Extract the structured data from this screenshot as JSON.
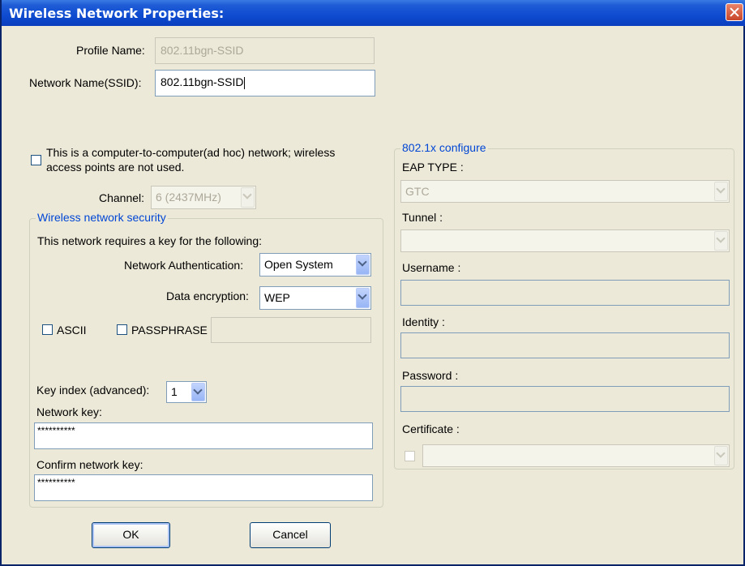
{
  "window": {
    "title": "Wireless Network Properties:"
  },
  "profile": {
    "label": "Profile Name:",
    "value": "802.11bgn-SSID"
  },
  "ssid": {
    "label": "Network Name(SSID):",
    "value": "802.11bgn-SSID"
  },
  "adhoc": {
    "label_line1": "This is a computer-to-computer(ad hoc) network; wireless",
    "label_line2": "access points are not used."
  },
  "channel": {
    "label": "Channel:",
    "value": "6  (2437MHz)"
  },
  "security": {
    "title": "Wireless network security",
    "requires_label": "This network requires a key for the following:",
    "auth_label": "Network Authentication:",
    "auth_value": "Open System",
    "enc_label": "Data encryption:",
    "enc_value": "WEP",
    "ascii_label": "ASCII",
    "passphrase_label": "PASSPHRASE",
    "passphrase_value": "",
    "key_index_label": "Key index (advanced):",
    "key_index_value": "1",
    "network_key_label": "Network key:",
    "network_key_value": "**********",
    "confirm_key_label": "Confirm network key:",
    "confirm_key_value": "**********"
  },
  "dot1x": {
    "title": "802.1x configure",
    "eap_label": "EAP TYPE :",
    "eap_value": "GTC",
    "tunnel_label": "Tunnel :",
    "tunnel_value": "",
    "username_label": "Username :",
    "username_value": "",
    "identity_label": "Identity :",
    "identity_value": "",
    "password_label": "Password :",
    "password_value": "",
    "certificate_label": "Certificate :",
    "certificate_value": ""
  },
  "buttons": {
    "ok": "OK",
    "cancel": "Cancel"
  }
}
